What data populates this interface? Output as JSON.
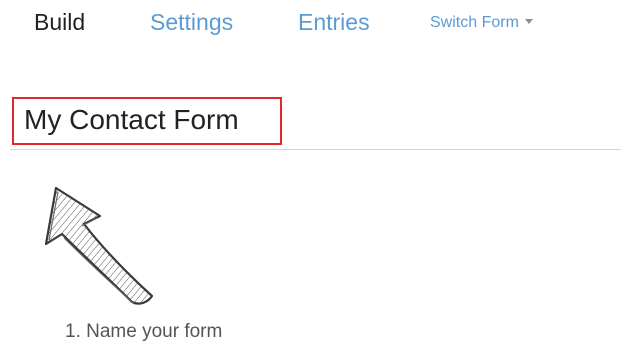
{
  "tabs": {
    "build": "Build",
    "settings": "Settings",
    "entries": "Entries"
  },
  "switch_form": {
    "label": "Switch Form",
    "icon": "caret-down-icon"
  },
  "form": {
    "title": "My Contact Form"
  },
  "hint": {
    "text": "1. Name your form",
    "icon": "hand-drawn-arrow-icon"
  },
  "colors": {
    "link": "#5b9bd5",
    "active_tab": "#222222",
    "highlight_border": "#e1262c",
    "divider": "#d7d7d7",
    "hint_text": "#555555"
  }
}
